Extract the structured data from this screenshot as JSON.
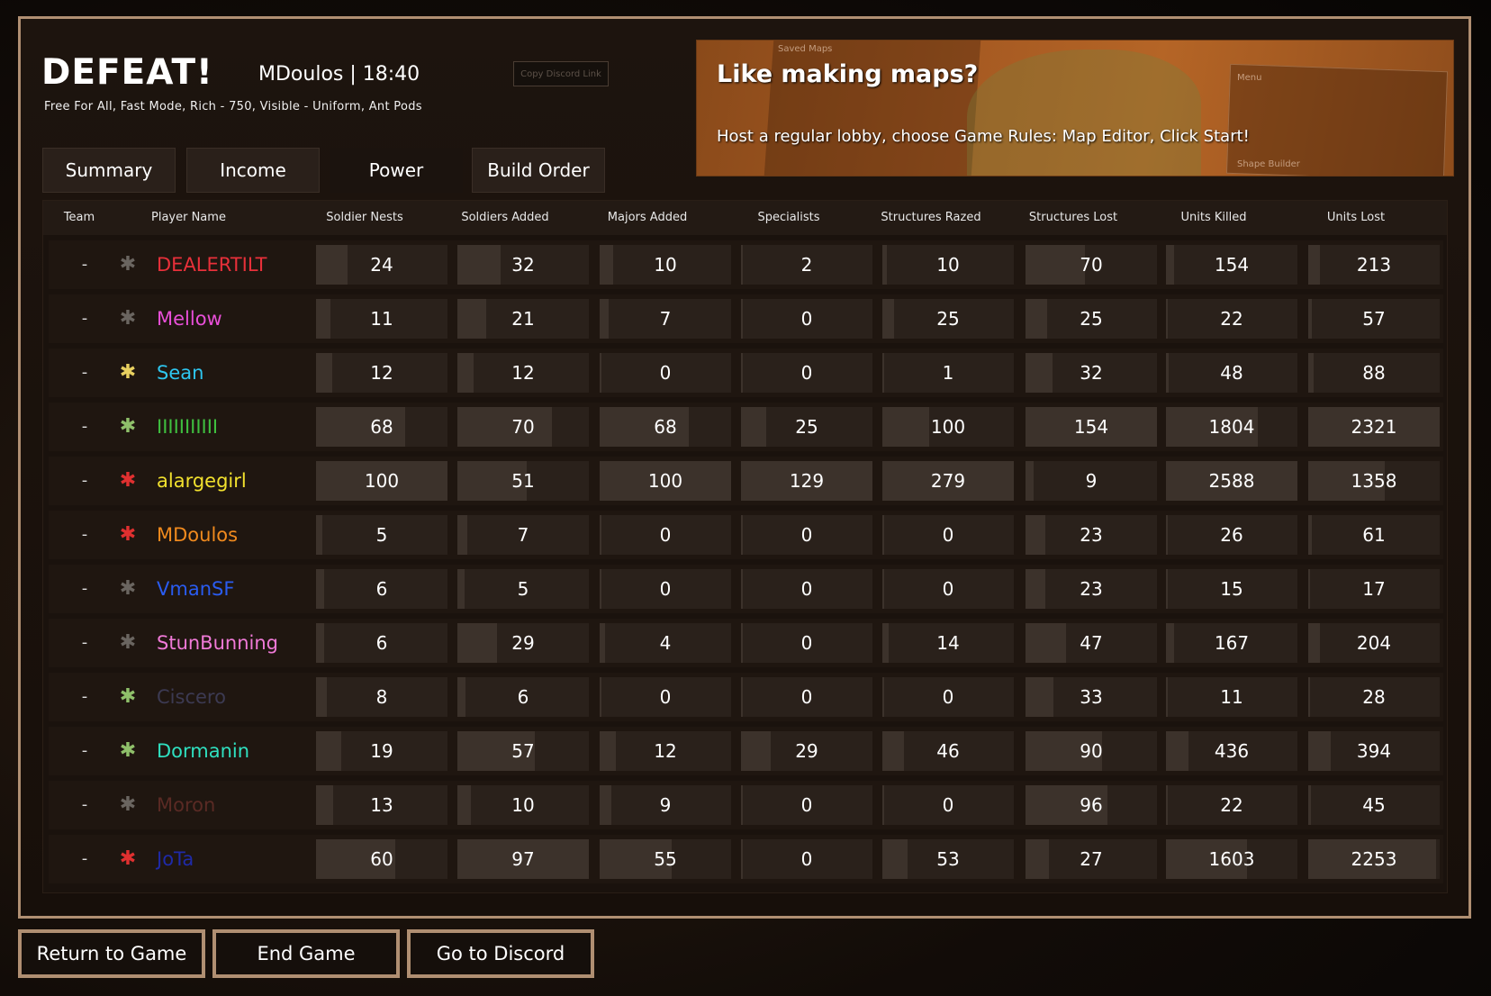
{
  "header": {
    "title": "DEFEAT!",
    "player_time": "MDoulos | 18:40",
    "subtitle": "Free For All, Fast Mode, Rich - 750, Visible - Uniform, Ant Pods",
    "copy_link_label": "Copy Discord Link"
  },
  "banner": {
    "headline": "Like making maps?",
    "body": "Host a regular lobby, choose Game Rules: Map Editor, Click Start!",
    "background_labels": [
      "Saved Maps",
      "Menu",
      "Shape Builder"
    ]
  },
  "tabs": [
    {
      "label": "Summary",
      "active": false
    },
    {
      "label": "Income",
      "active": false
    },
    {
      "label": "Power",
      "active": true
    },
    {
      "label": "Build Order",
      "active": false
    }
  ],
  "columns": [
    "Team",
    "Player Name",
    "Soldier Nests",
    "Soldiers Added",
    "Majors Added",
    "Specialists",
    "Structures Razed",
    "Structures Lost",
    "Units Killed",
    "Units Lost"
  ],
  "players": [
    {
      "team": "-",
      "name": "DEALERTILT",
      "color": "#e8303a",
      "icon": "black-ant-icon",
      "stats": [
        24,
        32,
        10,
        2,
        10,
        70,
        154,
        213
      ]
    },
    {
      "team": "-",
      "name": "Mellow",
      "color": "#e84fd8",
      "icon": "black-ant-icon",
      "stats": [
        11,
        21,
        7,
        0,
        25,
        25,
        22,
        57
      ]
    },
    {
      "team": "-",
      "name": "Sean",
      "color": "#2ec6f0",
      "icon": "yellow-ant-icon",
      "stats": [
        12,
        12,
        0,
        0,
        1,
        32,
        48,
        88
      ]
    },
    {
      "team": "-",
      "name": "IIIIIIIIIII",
      "color": "#3fbf3f",
      "icon": "green-ant-icon",
      "stats": [
        68,
        70,
        68,
        25,
        100,
        154,
        1804,
        2321
      ]
    },
    {
      "team": "-",
      "name": "alargegirl",
      "color": "#f2e12e",
      "icon": "red-ant-icon",
      "stats": [
        100,
        51,
        100,
        129,
        279,
        9,
        2588,
        1358
      ]
    },
    {
      "team": "-",
      "name": "MDoulos",
      "color": "#f08a1e",
      "icon": "red-ant-icon",
      "stats": [
        5,
        7,
        0,
        0,
        0,
        23,
        26,
        61
      ]
    },
    {
      "team": "-",
      "name": "VmanSF",
      "color": "#2a5cf0",
      "icon": "black-ant-icon",
      "stats": [
        6,
        5,
        0,
        0,
        0,
        23,
        15,
        17
      ]
    },
    {
      "team": "-",
      "name": "StunBunning",
      "color": "#f07ad8",
      "icon": "black-ant-icon",
      "stats": [
        6,
        29,
        4,
        0,
        14,
        47,
        167,
        204
      ]
    },
    {
      "team": "-",
      "name": "Ciscero",
      "color": "#3c3a52",
      "icon": "green-ant-icon",
      "stats": [
        8,
        6,
        0,
        0,
        0,
        33,
        11,
        28
      ]
    },
    {
      "team": "-",
      "name": "Dormanin",
      "color": "#2fe0c0",
      "icon": "green-ant-icon",
      "stats": [
        19,
        57,
        12,
        29,
        46,
        90,
        436,
        394
      ]
    },
    {
      "team": "-",
      "name": "Moron",
      "color": "#5a2a24",
      "icon": "black-ant-icon",
      "stats": [
        13,
        10,
        9,
        0,
        0,
        96,
        22,
        45
      ]
    },
    {
      "team": "-",
      "name": "JoTa",
      "color": "#1f2aa8",
      "icon": "red-ant-icon",
      "stats": [
        60,
        97,
        55,
        0,
        53,
        27,
        1603,
        2253
      ]
    }
  ],
  "buttons": {
    "return": "Return to Game",
    "end": "End Game",
    "discord": "Go to Discord"
  }
}
